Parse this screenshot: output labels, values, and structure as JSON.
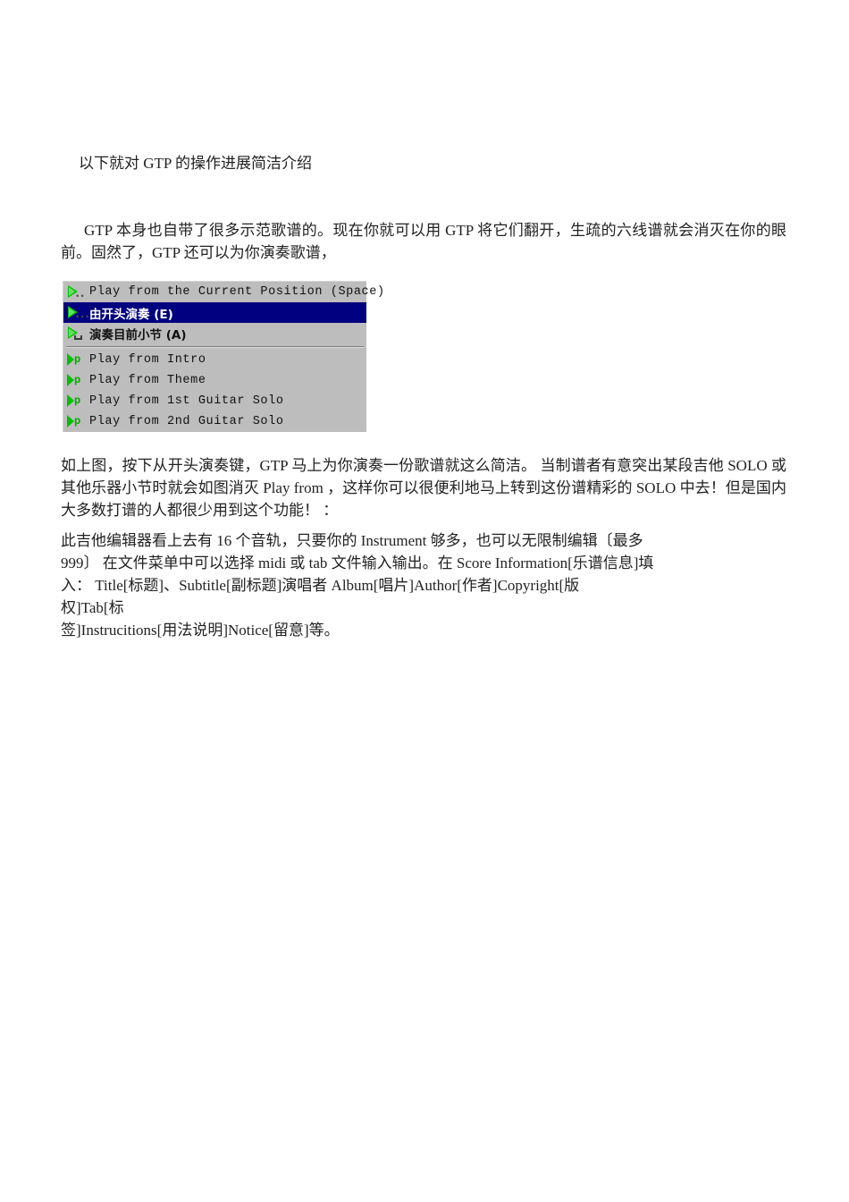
{
  "document": {
    "paragraphs": {
      "intro": "以下就对 GTP 的操作进展简洁介绍",
      "second": "GTP 本身也自带了很多示范歌谱的。现在你就可以用 GTP 将它们翻开，生疏的六线谱就会消灭在你的眼前。固然了，GTP 还可以为你演奏歌谱，",
      "third": "如上图，按下从开头演奏键，GTP 马上为你演奏一份歌谱就这么简洁。 当制谱者有意突出某段吉他 SOLO 或其他乐器小节时就会如图消灭 Play from ，这样你可以很便利地马上转到这份谱精彩的 SOLO 中去！但是国内大多数打谱的人都很少用到这个功能！ ：",
      "fourth_line1": "此吉他编辑器看上去有 16 个音轨，只要你的 Instrument 够多，也可以无限制编辑〔最多",
      "fourth_line2": "999〕 在文件菜单中可以选择 midi 或 tab 文件输入输出。在 Score Information[乐谱信息]填",
      "fourth_line3": "入： Title[标题]、Subtitle[副标题]演唱者 Album[唱片]Author[作者]Copyright[版",
      "fourth_line4": "权]Tab[标",
      "fourth_line5": "签]Instrucitions[用法说明]Notice[留意]等。"
    }
  },
  "menu_screenshot": {
    "background_color": "#bdbdbd",
    "highlight_color": "#000080",
    "highlight_text_color": "#ffffff",
    "icon_color": "#00c000",
    "items": [
      {
        "label": "Play from the Current Position (Space)",
        "icon": "play-triangle-icon",
        "selected": false,
        "script": "latin"
      },
      {
        "label": "由开头演奏 (E)",
        "icon": "play-triangle-icon",
        "selected": true,
        "script": "cjk"
      },
      {
        "label": "演奏目前小节 (A)",
        "icon": "play-triangle-icon",
        "selected": false,
        "script": "cjk"
      },
      {
        "label": "Play from Intro",
        "icon": "play-marker-p-icon",
        "selected": false,
        "script": "latin"
      },
      {
        "label": "Play from Theme",
        "icon": "play-marker-p-icon",
        "selected": false,
        "script": "latin"
      },
      {
        "label": "Play from 1st Guitar Solo",
        "icon": "play-marker-p-icon",
        "selected": false,
        "script": "latin"
      },
      {
        "label": "Play from 2nd Guitar Solo",
        "icon": "play-marker-p-icon",
        "selected": false,
        "script": "latin"
      }
    ]
  }
}
